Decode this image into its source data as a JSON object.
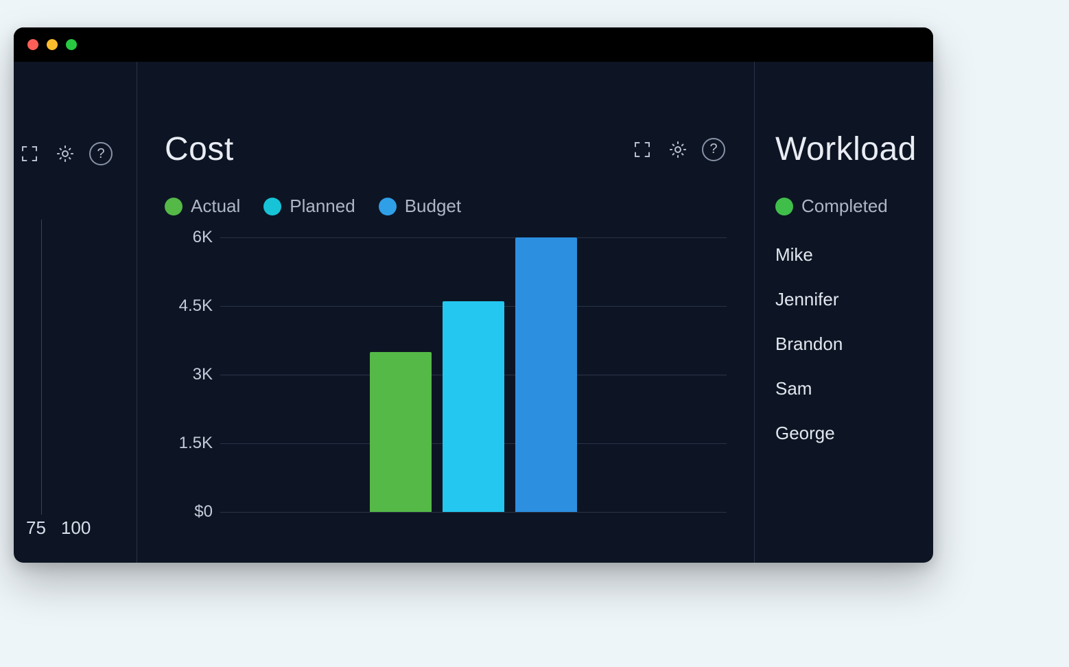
{
  "window": {
    "traffic_lights": [
      "close",
      "minimize",
      "zoom"
    ]
  },
  "left_panel": {
    "axis_fragment": [
      "75",
      "100"
    ]
  },
  "cost_panel": {
    "title": "Cost",
    "legend": [
      {
        "label": "Actual",
        "color": "#54b947"
      },
      {
        "label": "Planned",
        "color": "#17c3d6"
      },
      {
        "label": "Budget",
        "color": "#2f9fe8"
      }
    ],
    "y_ticks": [
      "6K",
      "4.5K",
      "3K",
      "1.5K",
      "$0"
    ]
  },
  "workload_panel": {
    "title": "Workload",
    "legend": {
      "label": "Completed",
      "color": "#3fbf4a"
    },
    "people": [
      "Mike",
      "Jennifer",
      "Brandon",
      "Sam",
      "George"
    ]
  },
  "colors": {
    "actual": "#54b947",
    "planned": "#24c7ef",
    "budget": "#2c8fe0"
  },
  "chart_data": {
    "type": "bar",
    "title": "Cost",
    "categories": [
      "Actual",
      "Planned",
      "Budget"
    ],
    "values": [
      3500,
      4600,
      6000
    ],
    "xlabel": "",
    "ylabel": "",
    "ylim": [
      0,
      6000
    ],
    "y_tick_labels": [
      "$0",
      "1.5K",
      "3K",
      "4.5K",
      "6K"
    ],
    "series_colors": {
      "Actual": "#54b947",
      "Planned": "#24c7ef",
      "Budget": "#2c8fe0"
    }
  }
}
